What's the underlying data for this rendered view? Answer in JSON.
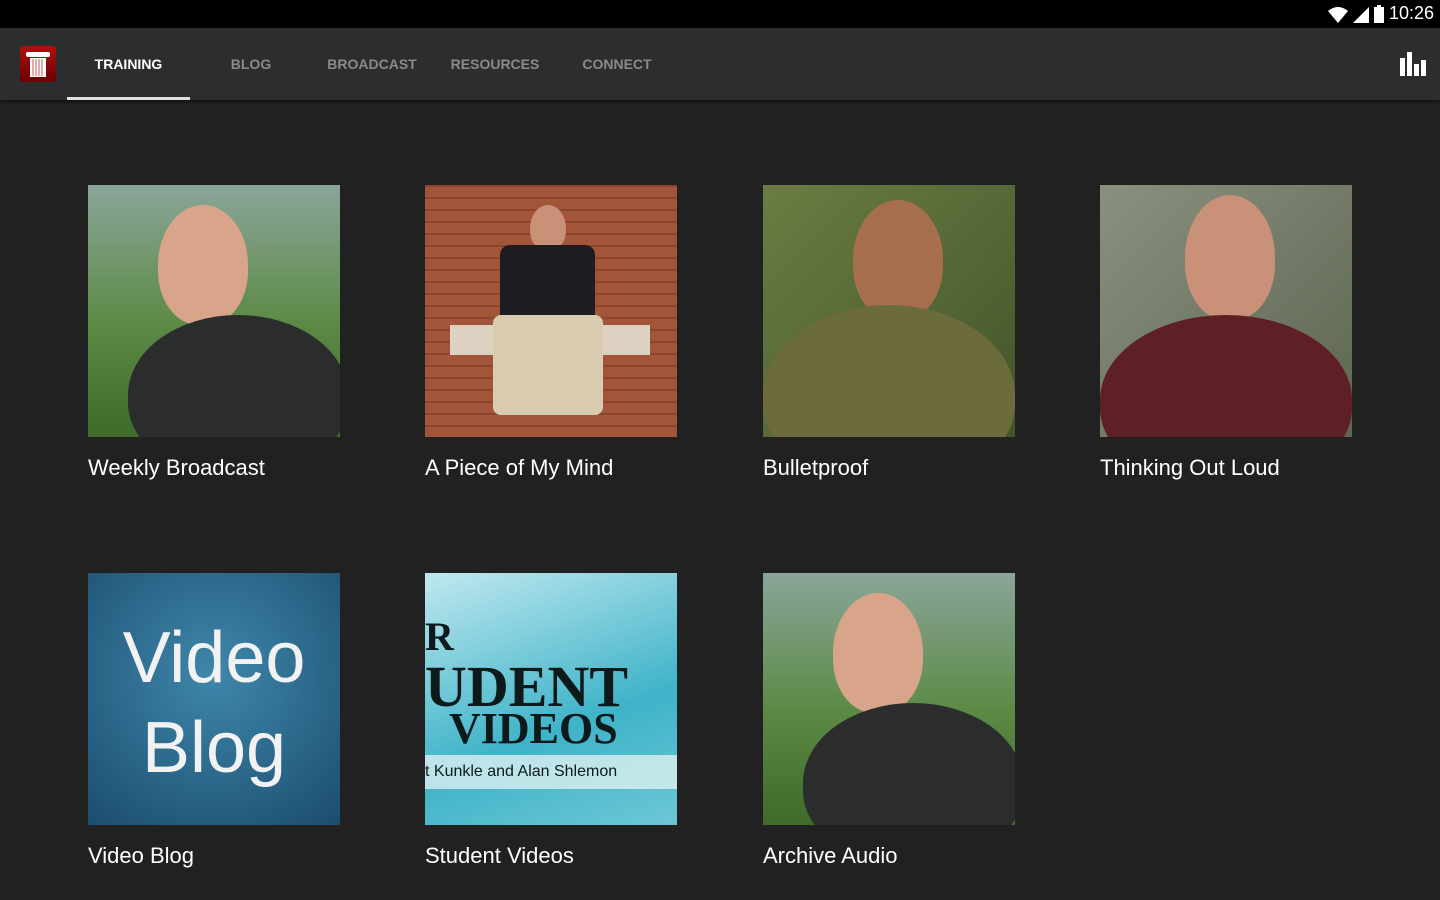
{
  "status_bar": {
    "time": "10:26"
  },
  "nav": {
    "tabs": [
      {
        "label": "TRAINING"
      },
      {
        "label": "BLOG"
      },
      {
        "label": "BROADCAST"
      },
      {
        "label": "RESOURCES"
      },
      {
        "label": "CONNECT"
      }
    ],
    "active": "TRAINING"
  },
  "tiles": [
    {
      "label": "Weekly Broadcast"
    },
    {
      "label": "A Piece of My Mind"
    },
    {
      "label": "Bulletproof"
    },
    {
      "label": "Thinking Out Loud"
    },
    {
      "label": "Video Blog",
      "thumb_text": [
        "Video",
        "Blog"
      ]
    },
    {
      "label": "Student Videos",
      "thumb_text": [
        "R",
        "UDENT",
        "VIDEOS",
        "t Kunkle and Alan Shlemon"
      ]
    },
    {
      "label": "Archive Audio"
    }
  ]
}
